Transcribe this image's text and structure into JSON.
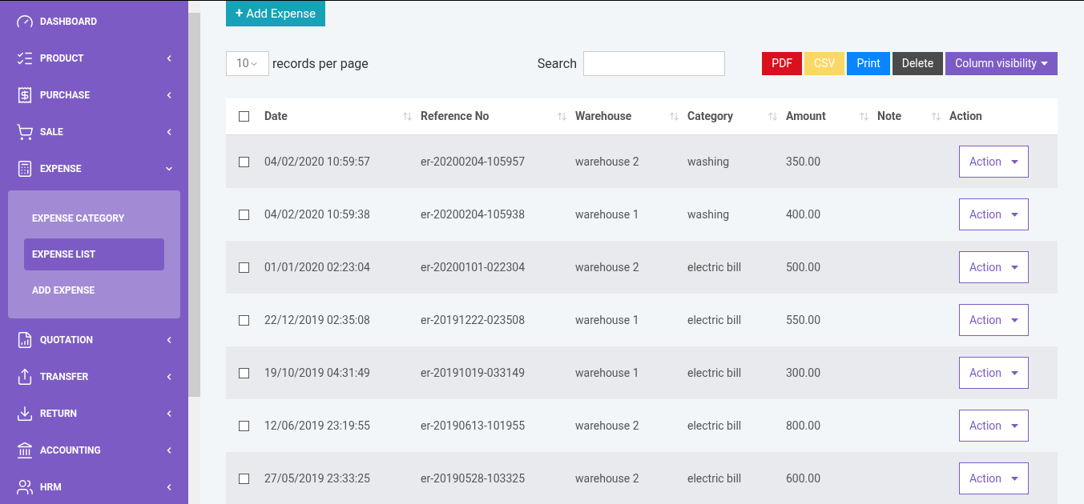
{
  "sidebar": {
    "items": [
      {
        "label": "DASHBOARD",
        "has_children": false,
        "expanded": false
      },
      {
        "label": "PRODUCT",
        "has_children": true,
        "expanded": false
      },
      {
        "label": "PURCHASE",
        "has_children": true,
        "expanded": false
      },
      {
        "label": "SALE",
        "has_children": true,
        "expanded": false
      },
      {
        "label": "EXPENSE",
        "has_children": true,
        "expanded": true,
        "children": [
          {
            "label": "EXPENSE CATEGORY",
            "selected": false
          },
          {
            "label": "EXPENSE LIST",
            "selected": true
          },
          {
            "label": "ADD EXPENSE",
            "selected": false
          }
        ]
      },
      {
        "label": "QUOTATION",
        "has_children": true,
        "expanded": false
      },
      {
        "label": "TRANSFER",
        "has_children": true,
        "expanded": false
      },
      {
        "label": "RETURN",
        "has_children": true,
        "expanded": false
      },
      {
        "label": "ACCOUNTING",
        "has_children": true,
        "expanded": false
      },
      {
        "label": "HRM",
        "has_children": true,
        "expanded": false
      }
    ]
  },
  "add_button": {
    "icon": "+",
    "label": "Add Expense"
  },
  "page_size": {
    "value": "10",
    "label": "records per page"
  },
  "search": {
    "label": "Search"
  },
  "export_buttons": [
    {
      "label": "PDF",
      "color": "#d9111f",
      "kind": "plain"
    },
    {
      "label": "CSV",
      "color": "#fbd765",
      "kind": "plain"
    },
    {
      "label": "Print",
      "color": "#0a84ff",
      "kind": "plain"
    },
    {
      "label": "Delete",
      "color": "#4b4b4b",
      "kind": "plain"
    },
    {
      "label": "Column visibility",
      "color": "#7c5cc4",
      "kind": "dropdown"
    }
  ],
  "table": {
    "select_all": {
      "checked": false
    },
    "columns": [
      {
        "label": "Date",
        "sortable": true
      },
      {
        "label": "Reference No",
        "sortable": true
      },
      {
        "label": "Warehouse",
        "sortable": true
      },
      {
        "label": "Category",
        "sortable": true
      },
      {
        "label": "Amount",
        "sortable": true
      },
      {
        "label": "Note",
        "sortable": true
      },
      {
        "label": "Action",
        "sortable": false
      }
    ],
    "rows": [
      {
        "checked": false,
        "date": "04/02/2020 10:59:57",
        "reference": "er-20200204-105957",
        "warehouse": "warehouse 2",
        "category": "washing",
        "amount": "350.00",
        "action": "Action"
      },
      {
        "checked": false,
        "date": "04/02/2020 10:59:38",
        "reference": "er-20200204-105938",
        "warehouse": "warehouse 1",
        "category": "washing",
        "amount": "400.00",
        "action": "Action"
      },
      {
        "checked": false,
        "date": "01/01/2020 02:23:04",
        "reference": "er-20200101-022304",
        "warehouse": "warehouse 2",
        "category": "electric bill",
        "amount": "500.00",
        "action": "Action"
      },
      {
        "checked": false,
        "date": "22/12/2019 02:35:08",
        "reference": "er-20191222-023508",
        "warehouse": "warehouse 1",
        "category": "electric bill",
        "amount": "550.00",
        "action": "Action"
      },
      {
        "checked": false,
        "date": "19/10/2019 04:31:49",
        "reference": "er-20191019-033149",
        "warehouse": "warehouse 1",
        "category": "electric bill",
        "amount": "300.00",
        "action": "Action"
      },
      {
        "checked": false,
        "date": "12/06/2019 23:19:55",
        "reference": "er-20190613-101955",
        "warehouse": "warehouse 2",
        "category": "electric bill",
        "amount": "800.00",
        "action": "Action"
      },
      {
        "checked": false,
        "date": "27/05/2019 23:33:25",
        "reference": "er-20190528-103325",
        "warehouse": "warehouse 2",
        "category": "electric bill",
        "amount": "600.00",
        "action": "Action"
      }
    ]
  }
}
